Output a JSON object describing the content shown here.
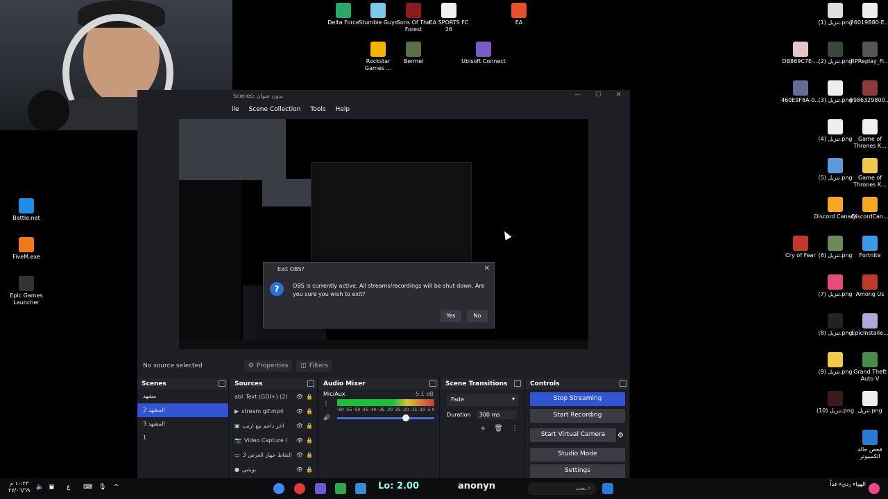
{
  "desktop_icons_top": [
    {
      "label": "Delta Force",
      "color": "#2aa86a"
    },
    {
      "label": "Stumble Guys",
      "color": "#7bc9e8"
    },
    {
      "label": "Sons Of The Forest",
      "color": "#8b1a1a"
    },
    {
      "label": "EA SPORTS FC 26",
      "color": "#f0f0f0"
    },
    {
      "label": "EA",
      "color": "#e8502a"
    },
    {
      "label": "Rockstar Games ...",
      "color": "#f5b400"
    },
    {
      "label": "Bermel",
      "color": "#5a6e4a"
    },
    {
      "label": "Ubisoft Connect",
      "color": "#7a5ac8"
    }
  ],
  "desktop_icons_left": [
    {
      "label": "Battle.net",
      "color": "#1f8ee6"
    },
    {
      "label": "FiveM.exe",
      "color": "#f07a1a"
    },
    {
      "label": "Epic Games Launcher",
      "color": "#333"
    }
  ],
  "desktop_icons_right": [
    {
      "label": "تنزيل (1).png",
      "color": "#ddd"
    },
    {
      "label": "76019B80-E...",
      "color": "#eee"
    },
    {
      "label": "DB869C7E-...",
      "color": "#e8c6c6"
    },
    {
      "label": "تنزيل (2).png",
      "color": "#3a4a3a"
    },
    {
      "label": "RPReplay_Fi...",
      "color": "#555"
    },
    {
      "label": "460E9F8A-0...",
      "color": "#6a6a9a"
    },
    {
      "label": "تنزيل (3).png",
      "color": "#eee"
    },
    {
      "label": "6986329800...",
      "color": "#8a3a3a"
    },
    {
      "label": "تنزيل (4).png",
      "color": "#eee"
    },
    {
      "label": "Game of Thrones K...",
      "color": "#f0f0f0"
    },
    {
      "label": "تنزيل (5).png",
      "color": "#5a9ad8"
    },
    {
      "label": "Game of Thrones K...",
      "color": "#f2c94c"
    },
    {
      "label": "Discord Canary",
      "color": "#f5a623"
    },
    {
      "label": "DiscordCan...",
      "color": "#f5a623"
    },
    {
      "label": "Cry of Fear",
      "color": "#c0392b"
    },
    {
      "label": "تنزيل (6).png",
      "color": "#6a8a5a"
    },
    {
      "label": "Fortnite",
      "color": "#3a9ae8"
    },
    {
      "label": "تنزيل (7).png",
      "color": "#e84a7a"
    },
    {
      "label": "Among Us",
      "color": "#c0392b"
    },
    {
      "label": "تنزيل (8).png",
      "color": "#222"
    },
    {
      "label": "EpicInstalle...",
      "color": "#aad"
    },
    {
      "label": "تنزيل (9).png",
      "color": "#f2c94c"
    },
    {
      "label": "Grand Theft Auto V",
      "color": "#4a8a4a"
    },
    {
      "label": "تنزيل (10).png",
      "color": "#3a1a1a"
    },
    {
      "label": "تنزيل.png",
      "color": "#eee"
    },
    {
      "label": "فحص حالة الكمبيوتر",
      "color": "#2a7ad8"
    }
  ],
  "obs": {
    "title": "Scenes: بدون عنوان",
    "menu": [
      "ile",
      "Scene Collection",
      "Tools",
      "Help"
    ],
    "no_source": "No source selected",
    "properties": "Properties",
    "filters": "Filters",
    "docks": {
      "scenes": "Scenes",
      "sources": "Sources",
      "audio_mixer": "Audio Mixer",
      "scene_transitions": "Scene Transitions",
      "controls": "Controls"
    },
    "scenes": [
      "مشهد",
      "2 المشهد",
      "3 المشهد",
      "1"
    ],
    "selected_scene_index": 1,
    "sources": [
      "Text (GDI+) (2)",
      "stream gif.mp4",
      "اخر داعم مع ارتب",
      "Video Capture I",
      "3 النقاط جهاز العرض",
      "بويتبي"
    ],
    "mixer": {
      "channel": "Mic/Aux",
      "db": "-5.1 dB",
      "scale": "-60 -55 -50 -45 -40 -35 -30 -25 -20 -15 -10 -5 0"
    },
    "transition": {
      "type": "Fade",
      "duration_label": "Duration",
      "duration": "300 ms"
    },
    "controls": [
      "Stop Streaming",
      "Start Recording",
      "Start Virtual Camera",
      "Studio Mode",
      "Settings"
    ]
  },
  "dialog": {
    "title": "Exit OBS?",
    "message": "OBS is currently active. All streams/recordings will be shut down. Are you sure you wish to exit?",
    "yes": "Yes",
    "no": "No"
  },
  "taskbar": {
    "time": "١٠:٢٣ م",
    "date": "٢٧/٠٦/٦٩",
    "search_placeholder": "بحث",
    "weather": "الهواء رديء غداً",
    "lang": "ع",
    "banner_text": "anonyn"
  }
}
